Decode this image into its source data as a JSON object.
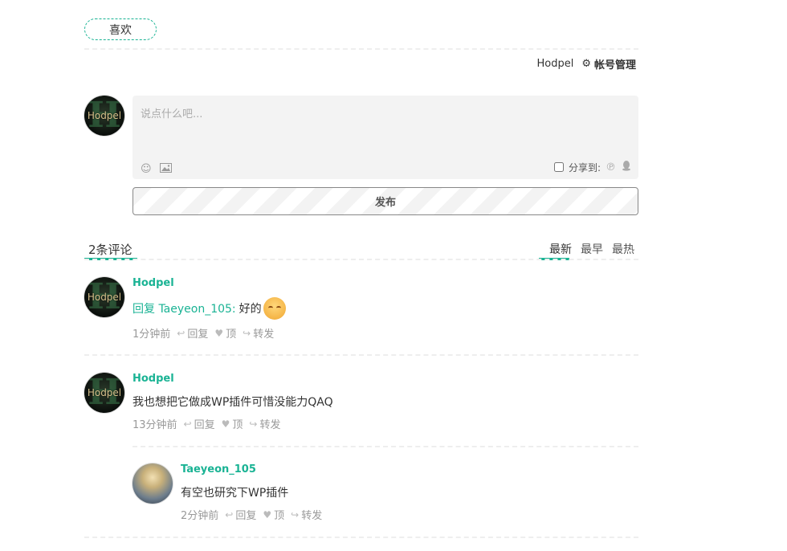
{
  "like_button": {
    "label": "喜欢"
  },
  "user_bar": {
    "username": "Hodpel",
    "account_label": "帐号管理"
  },
  "composer": {
    "placeholder": "说点什么吧...",
    "share_label": "分享到:",
    "publish_label": "发布"
  },
  "comments_header": {
    "count_label": "2条评论",
    "sort_tabs": [
      "最新",
      "最早",
      "最热"
    ],
    "active_sort": "最新"
  },
  "comments": [
    {
      "author": "Hodpel",
      "reply_to": "回复 Taeyeon_105:",
      "text": "好的",
      "time": "1分钟前",
      "reply_label": "回复",
      "upvote_label": "顶",
      "share_label": "转发"
    },
    {
      "author": "Hodpel",
      "text": "我也想把它做成WP插件可惜没能力QAQ",
      "time": "13分钟前",
      "reply_label": "回复",
      "upvote_label": "顶",
      "share_label": "转发"
    },
    {
      "author": "Taeyeon_105",
      "text": "有空也研究下WP插件",
      "time": "2分钟前",
      "reply_label": "回复",
      "upvote_label": "顶",
      "share_label": "转发"
    }
  ],
  "avatar_text": "Hodpel",
  "colors": {
    "accent": "#1ab394",
    "box_bg": "#f3f3f3"
  }
}
